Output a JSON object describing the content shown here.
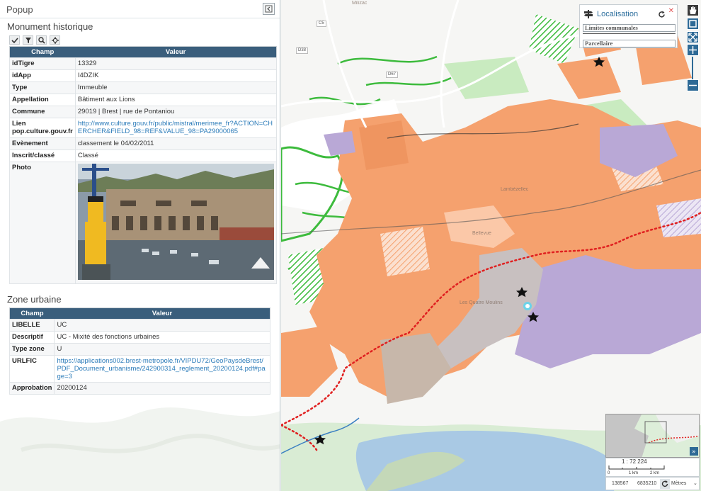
{
  "panel": {
    "title": "Popup",
    "monument": {
      "section_title": "Monument historique",
      "col_champ": "Champ",
      "col_valeur": "Valeur",
      "rows": [
        {
          "key": "idTigre",
          "value": "13329"
        },
        {
          "key": "idApp",
          "value": "I4DZIK"
        },
        {
          "key": "Type",
          "value": "Immeuble"
        },
        {
          "key": "Appellation",
          "value": "Bâtiment aux Lions"
        },
        {
          "key": "Commune",
          "value": "29019 | Brest | rue de Pontaniou"
        },
        {
          "key": "Lien pop.culture.gouv.fr",
          "value": "http://www.culture.gouv.fr/public/mistral/merimee_fr?ACTION=CHERCHER&FIELD_98=REF&VALUE_98=PA29000065"
        },
        {
          "key": "Evènement",
          "value": "classement le 04/02/2011"
        },
        {
          "key": "Inscrit/classé",
          "value": "Classé"
        },
        {
          "key": "Photo",
          "value": ""
        }
      ]
    },
    "zone": {
      "section_title": "Zone urbaine",
      "col_champ": "Champ",
      "col_valeur": "Valeur",
      "rows": [
        {
          "key": "LIBELLE",
          "value": "UC"
        },
        {
          "key": "Descriptif",
          "value": "UC - Mixité des fonctions urbaines"
        },
        {
          "key": "Type zone",
          "value": "U"
        },
        {
          "key": "URLFIC",
          "value": "https://applications002.brest-metropole.fr/VIPDU72/GeoPaysdeBrest/PDF_Document_urbanisme/242900314_reglement_20200124.pdf#page=3"
        },
        {
          "key": "Approbation",
          "value": "20200124"
        }
      ]
    }
  },
  "map": {
    "road_labels": [
      "C5",
      "D38",
      "D67"
    ],
    "town_labels": [
      "Milizac",
      "Les Quatre Moulins",
      "Bellevue",
      "Lambézellec"
    ],
    "localisation": {
      "title": "Localisation",
      "field_communes": "Limites communales",
      "field_parcellaire": "Parcellaire"
    },
    "scale": {
      "ratio": "1 : 72 224",
      "label_0": "0",
      "label_1": "1 km",
      "label_2": "2 km"
    },
    "coords": {
      "x": "138567",
      "y": "6835210",
      "unit": "Mètres"
    },
    "colors": {
      "urban_orange": "#f5a16e",
      "green_zone": "#3dbb3d",
      "purple_zone": "#b9a8d6",
      "sea": "#a9c9e4",
      "boundary_red": "#e02020",
      "toolbar_blue": "#2e6a96",
      "table_header": "#3a5e7c"
    }
  }
}
